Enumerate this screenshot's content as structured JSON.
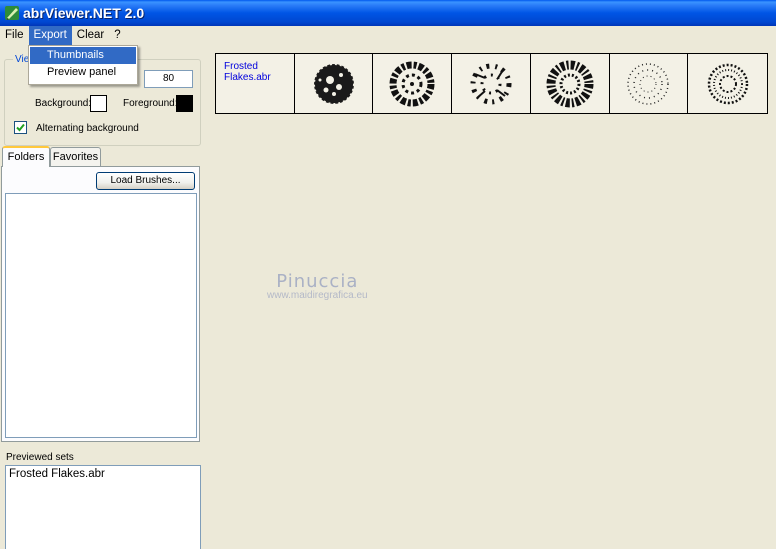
{
  "window": {
    "title": "abrViewer.NET 2.0"
  },
  "menu": {
    "items": [
      "File",
      "Export",
      "Clear",
      "?"
    ],
    "active": "Export",
    "export_items": [
      "Thumbnails",
      "Preview panel"
    ]
  },
  "view": {
    "legend": "Vie",
    "size_value": "80",
    "background_label": "Background:",
    "foreground_label": "Foreground:",
    "background_color": "#ffffff",
    "foreground_color": "#000000",
    "alternating_label": "Alternating background",
    "alternating_checked": true
  },
  "tabs": [
    "Folders",
    "Favorites"
  ],
  "load_brushes_label": "Load Brushes...",
  "previewed": {
    "label": "Previewed sets",
    "items": [
      "Frosted Flakes.abr"
    ]
  },
  "strip": {
    "file_name": "Frosted Flakes.abr",
    "brush_icons": [
      "brush-thumb-1",
      "brush-thumb-2",
      "brush-thumb-3",
      "brush-thumb-4",
      "brush-thumb-5",
      "brush-thumb-6"
    ]
  },
  "watermark": {
    "line1": "Pinuccia",
    "line2": "www.maidiregrafica.eu"
  }
}
